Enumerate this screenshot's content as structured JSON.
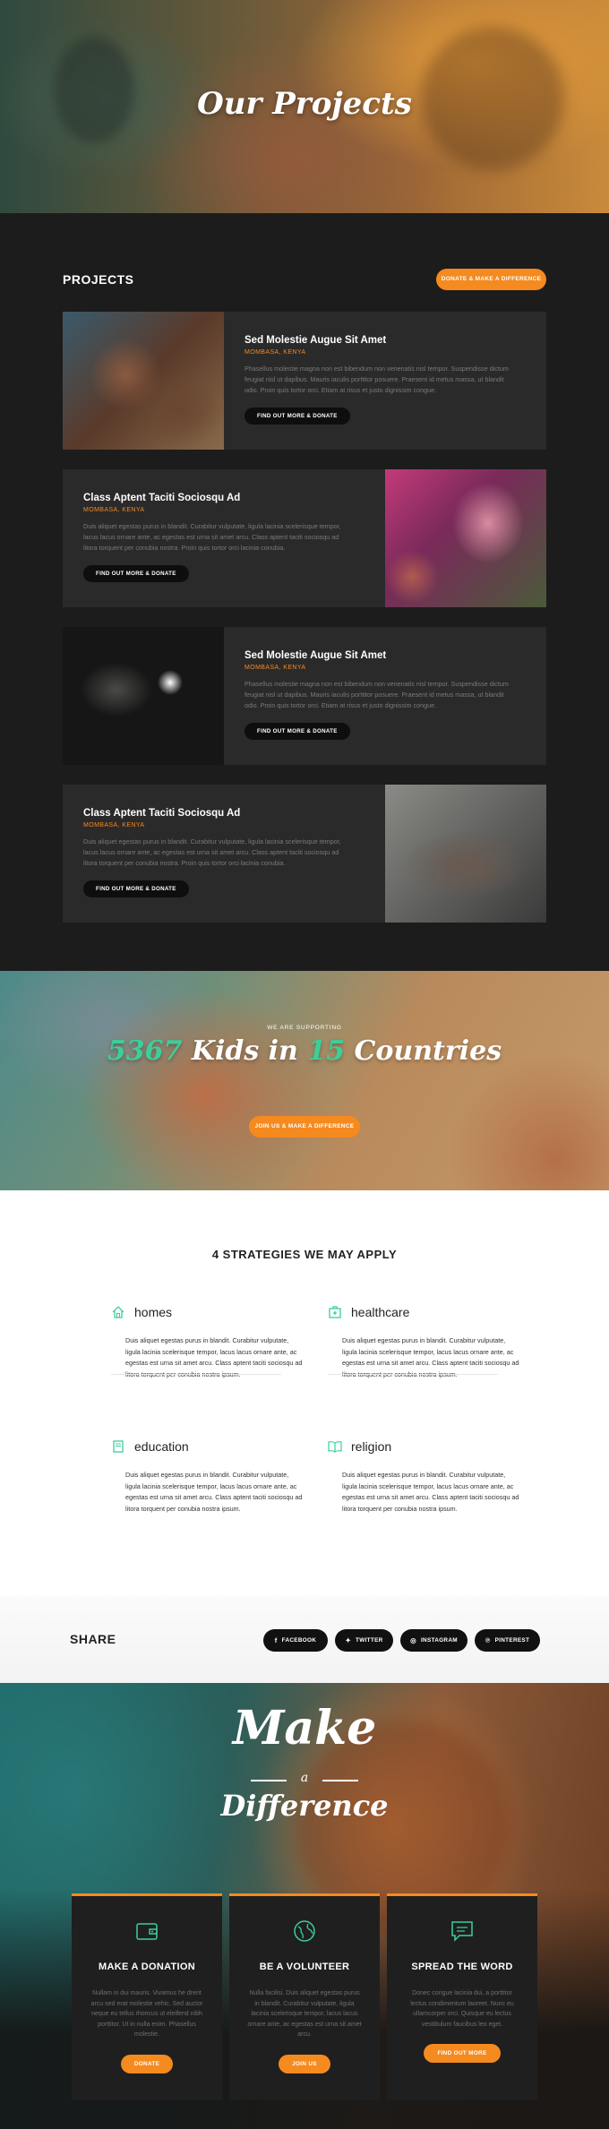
{
  "hero": {
    "title": "Our Projects"
  },
  "projects": {
    "heading": "PROJECTS",
    "donate_button": "DONATE & MAKE A DIFFERENCE",
    "cards": [
      {
        "title": "Sed Molestie Augue Sit Amet",
        "location": "MOMBASA, KENYA",
        "text": "Phasellus molestie magna non est bibendum non venenatis nisl tempor. Suspendisse dictum feugiat nisl ut dapibus. Mauris iaculis porttitor posuere. Praesent id metus massa, ut blandit odio. Proin quis tortor orci. Etiam at risus et justo dignissim congue.",
        "button": "FIND OUT MORE & DONATE"
      },
      {
        "title": "Class Aptent Taciti Sociosqu Ad",
        "location": "MOMBASA, KENYA",
        "text": "Duis aliquet egestas purus in blandit. Curabitur vulputate, ligula lacinia scelerisque tempor, lacus lacus ornare ante, ac egestas est urna sit amet arcu. Class aptent taciti sociosqu ad litora torquent per conubia nostra. Proin quis tortor orci lacinia conubia.",
        "button": "FIND OUT MORE & DONATE"
      },
      {
        "title": "Sed Molestie Augue Sit Amet",
        "location": "MOMBASA, KENYA",
        "text": "Phasellus molestie magna non est bibendum non venenatis nisl tempor. Suspendisse dictum feugiat nisl ut dapibus. Mauris iaculis porttitor posuere. Praesent id metus massa, ut blandit odio. Proin quis tortor orci. Etiam at risus et justo dignissim congue.",
        "button": "FIND OUT MORE & DONATE"
      },
      {
        "title": "Class Aptent Taciti Sociosqu Ad",
        "location": "MOMBASA, KENYA",
        "text": "Duis aliquet egestas purus in blandit. Curabitur vulputate, ligula lacinia scelerisque tempor, lacus lacus ornare ante, ac egestas est urna sit amet arcu. Class aptent taciti sociosqu ad litora torquent per conubia nostra. Proin quis tortor orci lacinia conubia.",
        "button": "FIND OUT MORE & DONATE"
      }
    ]
  },
  "kids": {
    "supporting": "WE ARE SUPPORTING",
    "kids_count": "5367",
    "kids_text": "Kids in",
    "countries_count": "15",
    "countries_text": "Countries",
    "button": "JOIN US & MAKE A DIFFERENCE"
  },
  "strategies": {
    "title": "4 STRATEGIES WE MAY APPLY",
    "items": [
      {
        "icon": "home-icon",
        "name": "homes",
        "text": "Duis aliquet egestas purus in blandit. Curabitur vulputate, ligula lacinia scelerisque tempor, lacus lacus ornare ante, ac egestas est urna sit amet arcu. Class aptent taciti sociosqu ad litora torquent per conubia nostra ipsum."
      },
      {
        "icon": "medical-icon",
        "name": "healthcare",
        "text": "Duis aliquet egestas purus in blandit. Curabitur vulputate, ligula lacinia scelerisque tempor, lacus lacus ornare ante, ac egestas est urna sit amet arcu. Class aptent taciti sociosqu ad litora torquent per conubia nostra ipsum."
      },
      {
        "icon": "book-icon",
        "name": "education",
        "text": "Duis aliquet egestas purus in blandit. Curabitur vulputate, ligula lacinia scelerisque tempor, lacus lacus ornare ante, ac egestas est urna sit amet arcu. Class aptent taciti sociosqu ad litora torquent per conubia nostra ipsum."
      },
      {
        "icon": "open-book-icon",
        "name": "religion",
        "text": "Duis aliquet egestas purus in blandit. Curabitur vulputate, ligula lacinia scelerisque tempor, lacus lacus ornare ante, ac egestas est urna sit amet arcu. Class aptent taciti sociosqu ad litora torquent per conubia nostra ipsum."
      }
    ]
  },
  "share": {
    "label": "SHARE",
    "buttons": [
      {
        "icon": "facebook-icon",
        "glyph": "f",
        "label": "FACEBOOK"
      },
      {
        "icon": "twitter-icon",
        "glyph": "✦",
        "label": "TWITTER"
      },
      {
        "icon": "instagram-icon",
        "glyph": "◎",
        "label": "INSTAGRAM"
      },
      {
        "icon": "pinterest-icon",
        "glyph": "℗",
        "label": "PINTEREST"
      }
    ]
  },
  "make": {
    "line1": "Make",
    "line2": "a",
    "line3": "Difference",
    "cards": [
      {
        "icon": "wallet-icon",
        "title": "MAKE A DONATION",
        "text": "Nullam in dui mauris. Vivamus he drerit arcu sed erat molestie vehic. Sed auctor neque eu tellus rhoncus ut eleifend nibh porttitor. Ut in nulla enim. Phasellus molestie.",
        "button": "DONATE"
      },
      {
        "icon": "globe-icon",
        "title": "BE A VOLUNTEER",
        "text": "Nulla facilisi. Duis aliquet egestas purus in blandit. Curabitur vulputate, ligula lacinia scelerisque tempor, lacus lacus ornare ante, ac egestas est urna sit amet arcu.",
        "button": "JOIN US"
      },
      {
        "icon": "message-icon",
        "title": "SPREAD THE WORD",
        "text": "Donec congue lacinia dui, a porttitor lectus condimentum laoreet. Nunc eu ullamcorper orci. Quisque eu lectus vestibulum faucibus leo eget.",
        "button": "FIND OUT MORE"
      }
    ]
  },
  "colors": {
    "accent": "#f58a1f",
    "teal": "#3ccf9a",
    "dark": "#1c1c1c",
    "card": "#2a2a2a"
  }
}
